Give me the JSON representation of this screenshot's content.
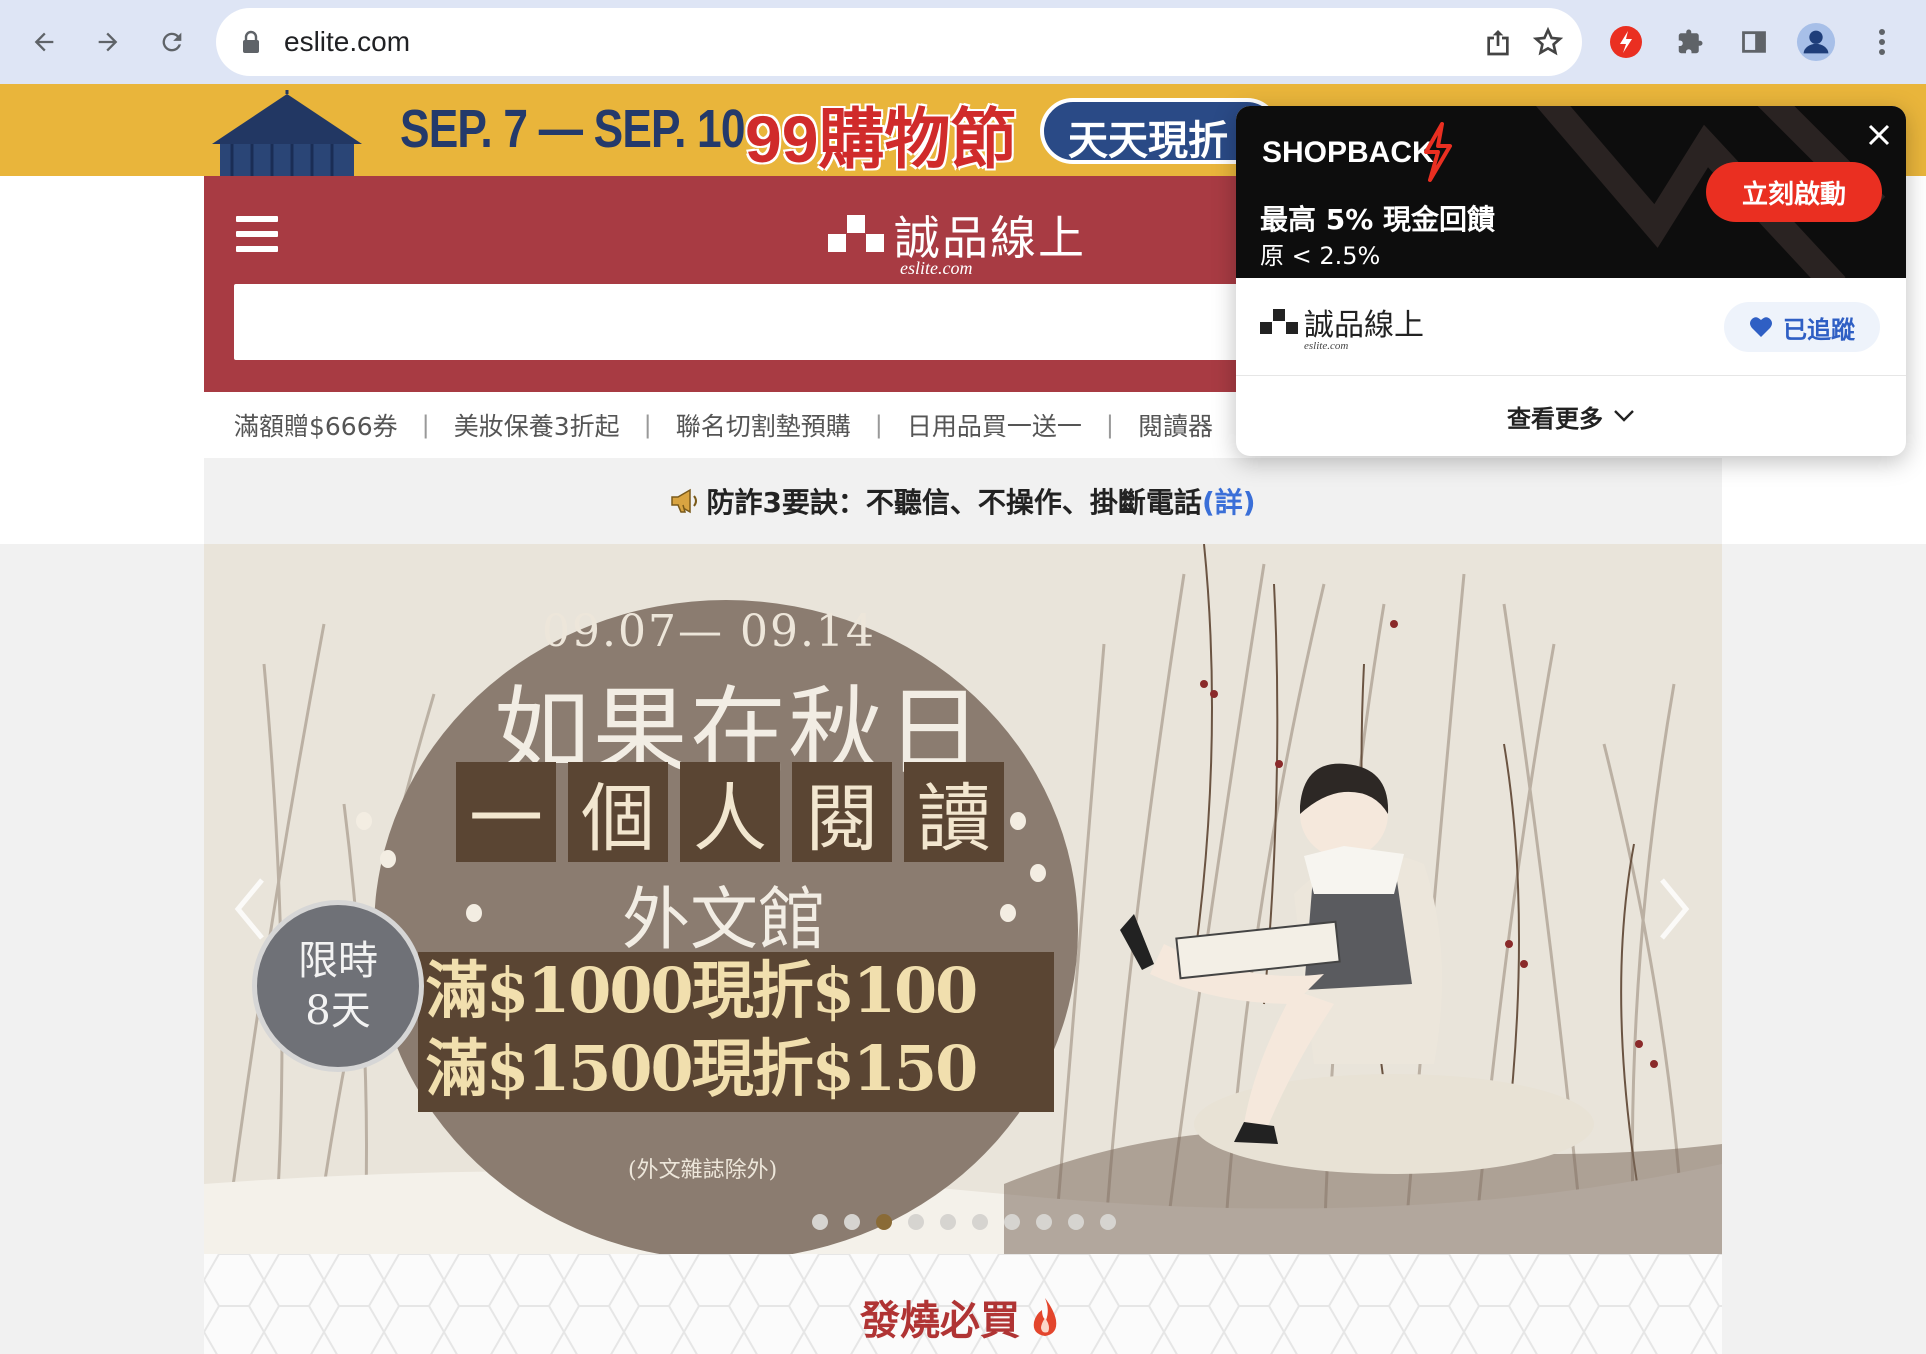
{
  "browser": {
    "url": "eslite.com"
  },
  "promo_banner": {
    "dates": "SEP. 7 — SEP. 10",
    "festival": "99購物節",
    "pill": "天天現折"
  },
  "site": {
    "logo_text": "誠品線上",
    "logo_sub": "eslite.com",
    "search_placeholder": ""
  },
  "quicklinks": [
    "滿額贈$666券",
    "美妝保養3折起",
    "聯名切割墊預購",
    "日用品買一送一",
    "閱讀器"
  ],
  "quicklink_separator": "|",
  "notice": {
    "text": "防詐3要訣：不聽信、不操作、掛斷電話",
    "link": "(詳)"
  },
  "hero": {
    "date_range": "09.07— 09.14",
    "title": "如果在秋日",
    "boxed_chars": [
      "一",
      "個",
      "人",
      "閱",
      "讀"
    ],
    "subtitle": "外文館",
    "deal_1": "滿$1000現折$100",
    "deal_2": "滿$1500現折$150",
    "note": "(外文雜誌除外)",
    "badge_line1": "限時",
    "badge_line2": "8天",
    "page_count": 10,
    "active_page": 3
  },
  "hot_section": {
    "title": "發燒必買"
  },
  "shopback": {
    "brand": "SHOPBACK",
    "cta": "立刻啟動",
    "rate": "最高 5% 現金回饋",
    "original": "原 < 2.5%",
    "merchant_name": "誠品線上",
    "merchant_sub": "eslite.com",
    "follow_label": "已追蹤",
    "more_label": "查看更多"
  },
  "colors": {
    "chrome_bg": "#dee5f5",
    "header_red": "#a83b43",
    "shopback_red": "#ea2f21",
    "follow_blue": "#2f5fc4",
    "hot_title": "#b03434"
  }
}
